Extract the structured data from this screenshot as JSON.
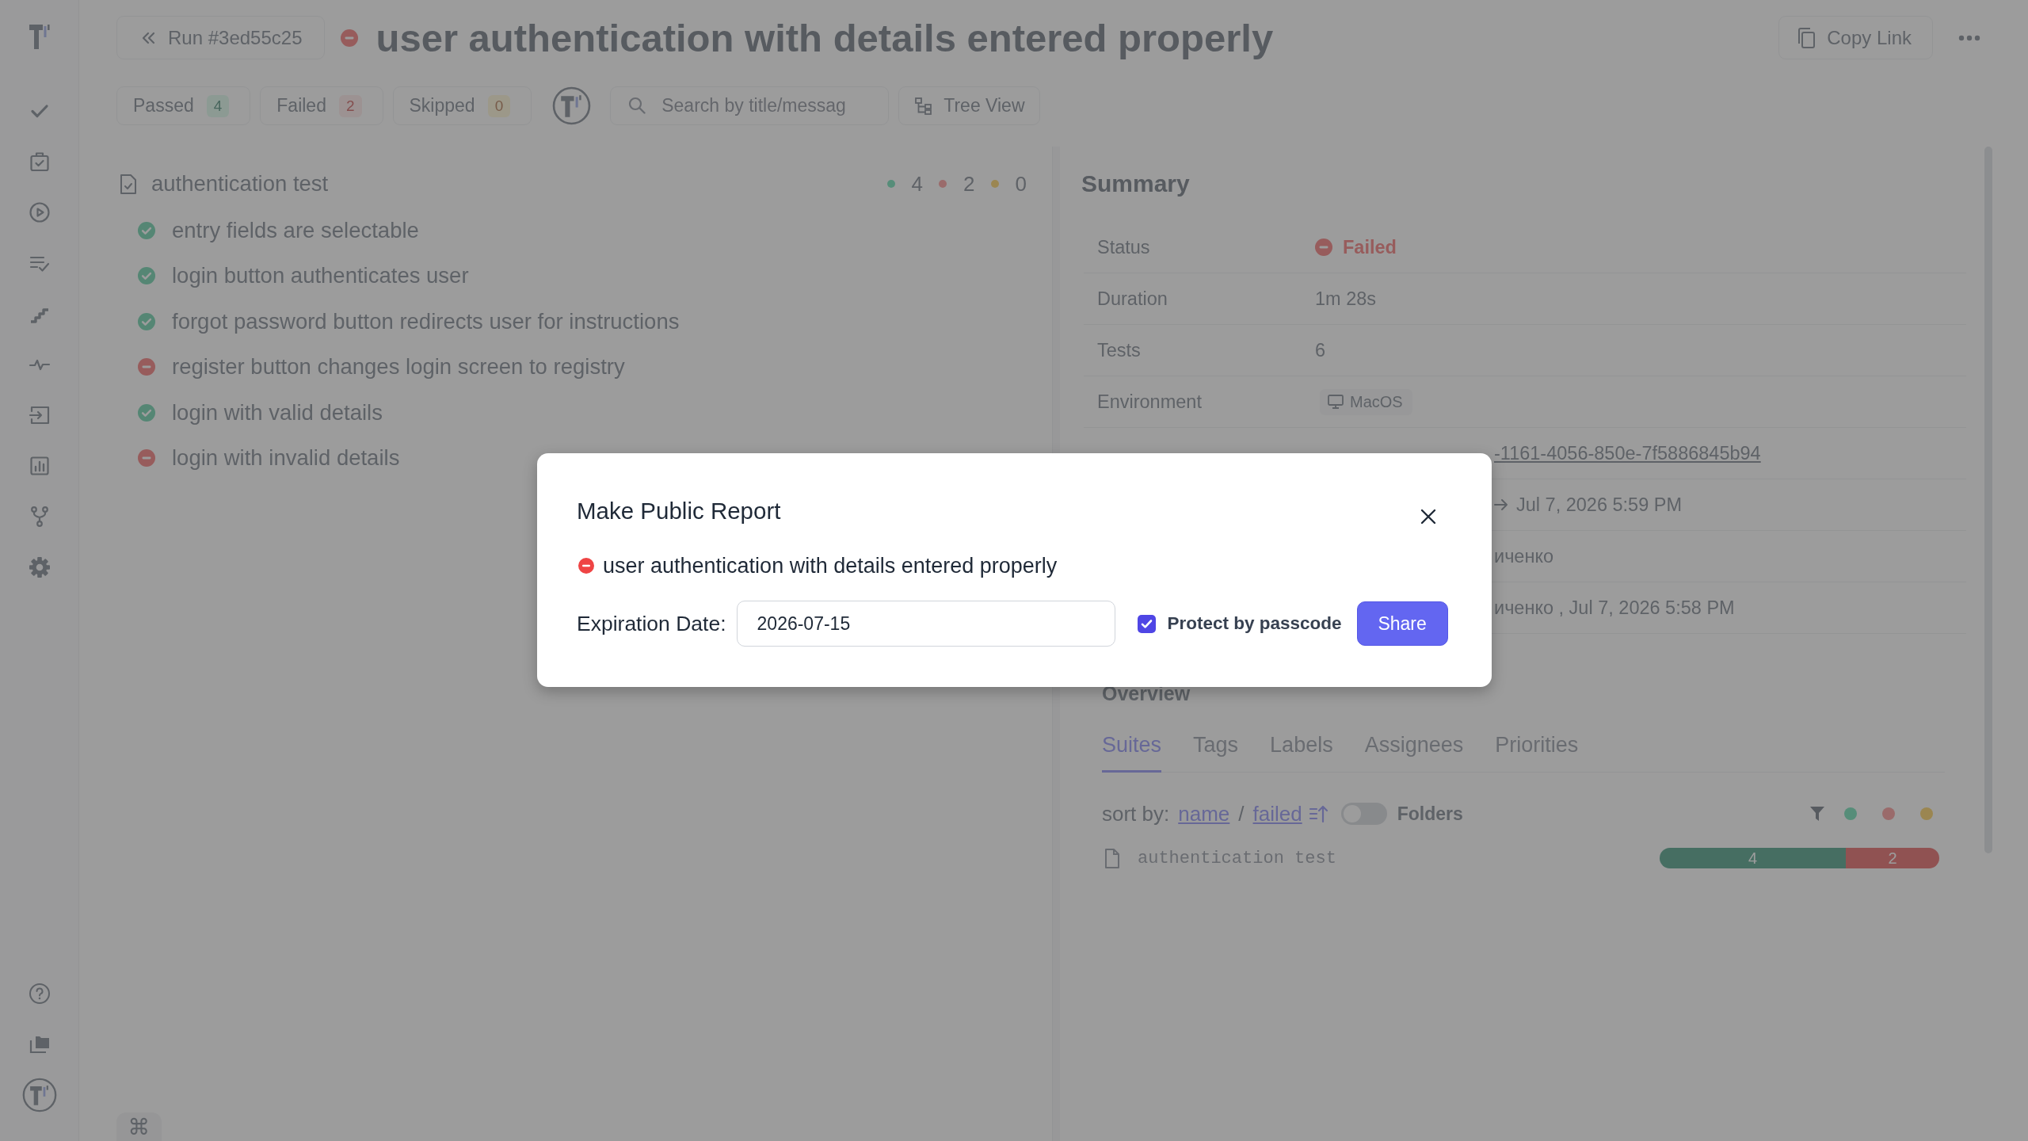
{
  "header": {
    "run_button": "Run #3ed55c25",
    "failed": true,
    "title": "user authentication with details entered properly",
    "copy_link": "Copy Link"
  },
  "filters": {
    "chips": [
      {
        "kind": "passed",
        "label": "Passed",
        "count": "4"
      },
      {
        "kind": "failed",
        "label": "Failed",
        "count": "2"
      },
      {
        "kind": "skipped",
        "label": "Skipped",
        "count": "0"
      }
    ],
    "search": {
      "placeholder": "Search by title/messag"
    },
    "view_button": "Tree View"
  },
  "suite": {
    "title": "authentication test",
    "counts": [
      {
        "kind": "passed",
        "value": "4"
      },
      {
        "kind": "failed",
        "value": "2"
      },
      {
        "kind": "skipped",
        "value": "0"
      }
    ],
    "tests": [
      {
        "title": "entry fields are selectable",
        "failed": false
      },
      {
        "title": "login button authenticates user",
        "failed": false
      },
      {
        "title": "forgot password button redirects user for instructions",
        "failed": false
      },
      {
        "title": "register button changes login screen to registry",
        "failed": true
      },
      {
        "title": "login with valid details",
        "failed": false
      },
      {
        "title": "login with invalid details",
        "failed": true
      }
    ]
  },
  "shortcut_key": "⌘",
  "summary": {
    "title": "Summary",
    "rows": [
      {
        "kind": "status",
        "label": "Status",
        "value": "Failed",
        "failed": true
      },
      {
        "kind": "text",
        "label": "Duration",
        "value": "1m 28s"
      },
      {
        "kind": "text",
        "label": "Tests",
        "value": "6"
      },
      {
        "kind": "tag",
        "label": "Environment",
        "value": "MacOS"
      },
      {
        "kind": "covered_link",
        "value": "-1161-4056-850e-7f5886845b94"
      },
      {
        "kind": "covered_range",
        "value": "Jul 7, 2026 5:59 PM"
      },
      {
        "kind": "covered",
        "value": "иченко"
      },
      {
        "kind": "covered",
        "value": "иченко , Jul 7, 2026 5:58 PM"
      }
    ]
  },
  "overview": {
    "title": "Overview",
    "tabs": [
      {
        "label": "Suites",
        "selected": true
      },
      {
        "label": "Tags",
        "selected": false
      },
      {
        "label": "Labels",
        "selected": false
      },
      {
        "label": "Assignees",
        "selected": false
      },
      {
        "label": "Priorities",
        "selected": false
      }
    ],
    "sort": {
      "label": "sort by:",
      "options": [
        "name",
        "failed"
      ],
      "separator": "/",
      "ascending": true,
      "toggle": {
        "label": "Folders",
        "on": false
      }
    },
    "legend": [
      {
        "kind": "passed"
      },
      {
        "kind": "failed"
      },
      {
        "kind": "skipped"
      }
    ],
    "suites": [
      {
        "title": "authentication test",
        "passed": "4",
        "failed": "2"
      }
    ]
  },
  "modal": {
    "title": "Make Public Report",
    "failed": true,
    "test_title": "user authentication with details entered properly",
    "expiration": {
      "label": "Expiration Date:",
      "value": "2026-07-15"
    },
    "passcode": {
      "label": "Protect by passcode",
      "checked": true
    },
    "share_button": "Share"
  }
}
